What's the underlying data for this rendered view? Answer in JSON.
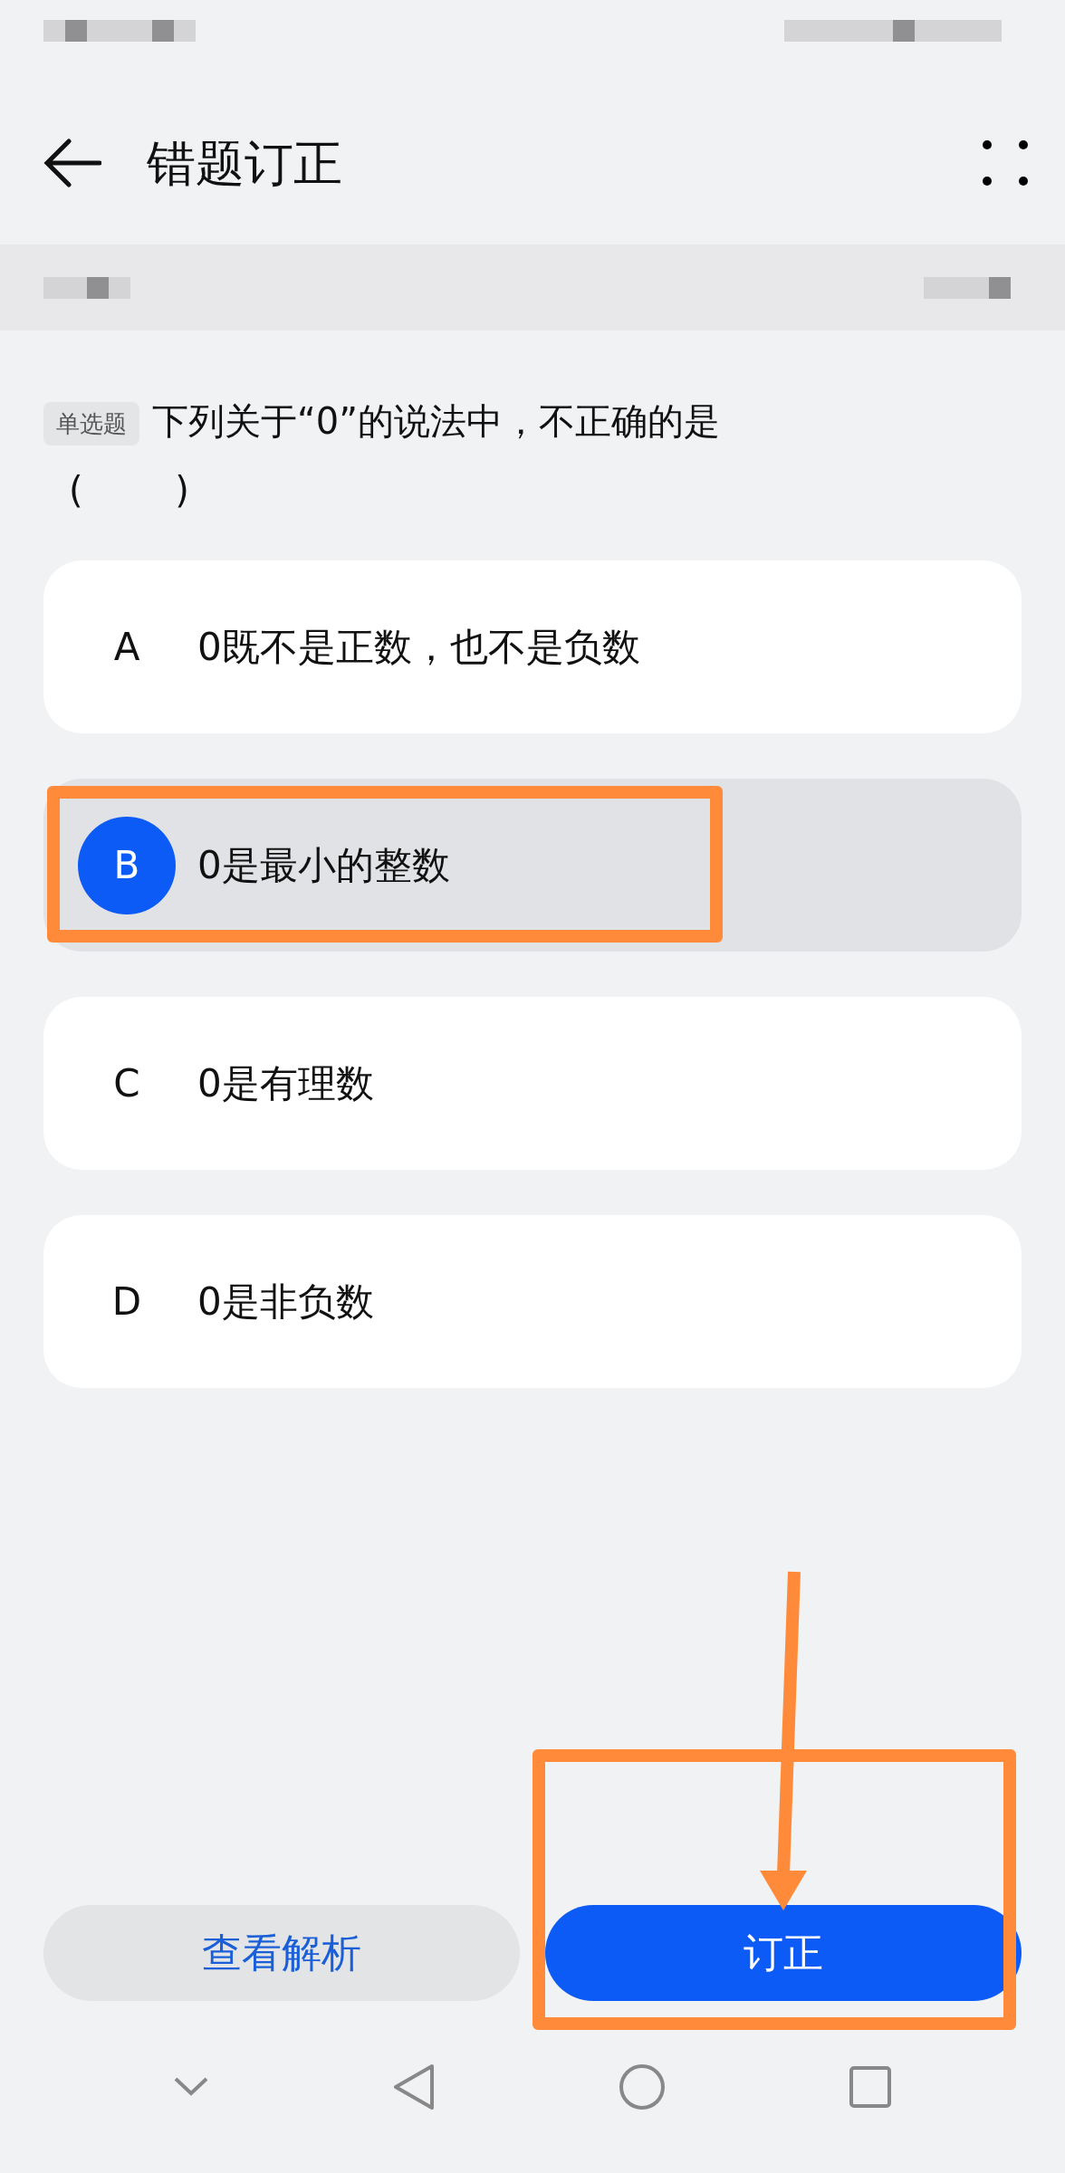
{
  "header": {
    "title": "错题订正"
  },
  "question": {
    "type_tag": "单选题",
    "text": "下列关于“0”的说法中，不正确的是",
    "blank": "(        )"
  },
  "options": [
    {
      "letter": "A",
      "text": "0既不是正数，也不是负数",
      "selected": false
    },
    {
      "letter": "B",
      "text": "0是最小的整数",
      "selected": true
    },
    {
      "letter": "C",
      "text": "0是有理数",
      "selected": false
    },
    {
      "letter": "D",
      "text": "0是非负数",
      "selected": false
    }
  ],
  "buttons": [
    {
      "label": "查看解析",
      "kind": "secondary"
    },
    {
      "label": "订正",
      "kind": "primary"
    }
  ],
  "annotations": {
    "highlight_selected_option": true,
    "highlight_primary_button": true,
    "arrow_to_primary_button": true
  }
}
